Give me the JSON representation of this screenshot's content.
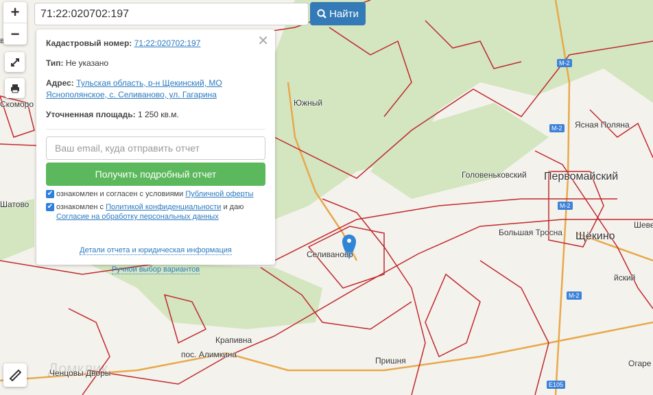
{
  "search": {
    "value": "71:22:020702:197",
    "button": "Найти"
  },
  "controls": {
    "zoom_in": "+",
    "zoom_out": "−"
  },
  "panel": {
    "cadastral_label": "Кадастровый номер:",
    "cadastral_value": "71:22:020702:197",
    "type_label": "Тип:",
    "type_value": "Не указано",
    "address_label": "Адрес:",
    "address_value": "Тульская область, р-н Щекинский, МО Яснополянское, с. Селиваново, ул. Гагарина",
    "area_label": "Уточненная площадь:",
    "area_value": "1 250 кв.м.",
    "email_placeholder": "Ваш email, куда отправить отчет",
    "submit": "Получить подробный отчет",
    "consent1_text": "ознакомлен и согласен с условиями ",
    "consent1_link": "Публичной оферты",
    "consent1_checked": true,
    "consent2_text": "ознакомлен с ",
    "consent2_link": "Политикой конфиденциальности",
    "consent2_after": " и даю",
    "consent2_link2": "Согласие на обработку персональных данных",
    "consent2_checked": true,
    "details_link": "Детали отчета и юридическая информация",
    "manual_link": "Ручной выбор вариантов"
  },
  "map": {
    "labels": [
      "Южный",
      "Головеньковский",
      "Первомайский",
      "Ясная Поляна",
      "Большая Тросна",
      "Щёкино",
      "Шеве",
      "йский",
      "Селиваново",
      "Крапивна",
      "пос. Алимкина",
      "Пришня",
      "Ченцовы Дворы",
      "Скоморо",
      "Шатово",
      "вский",
      "Огаре"
    ],
    "road_shields": [
      "М-2",
      "М-2",
      "М-2",
      "М-2",
      "E105"
    ],
    "watermark": "Домклик",
    "parcel_color": "#c0282d",
    "forest_color": "#d3e6c0",
    "marker_color": "#2f86d6"
  }
}
